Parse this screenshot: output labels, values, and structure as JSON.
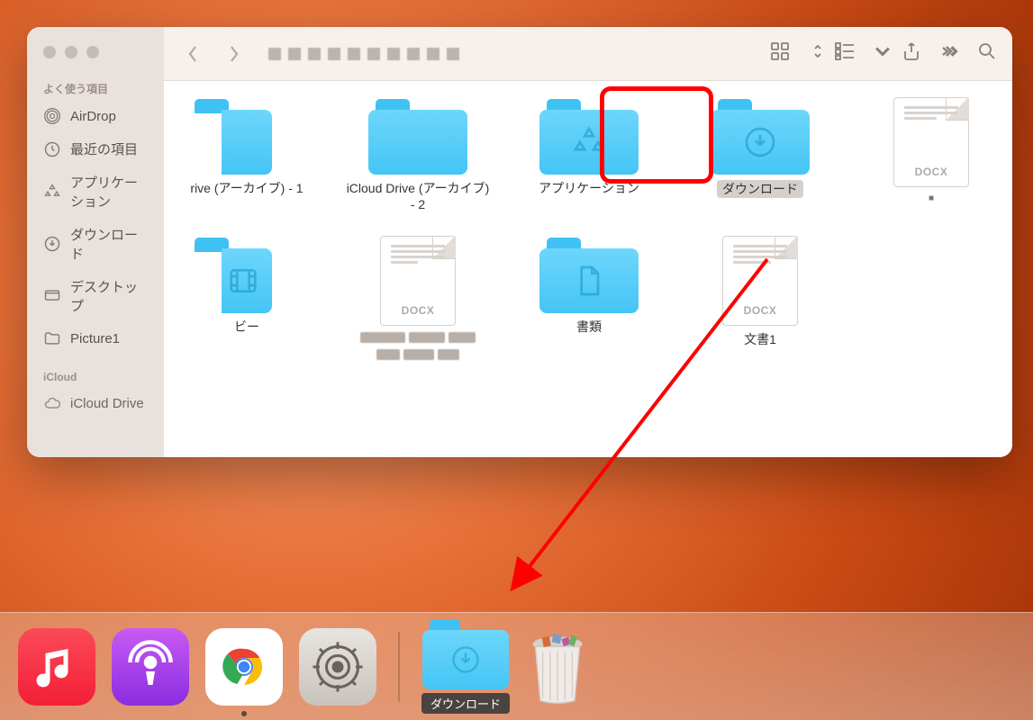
{
  "sidebar": {
    "favorites_header": "よく使う項目",
    "icloud_header": "iCloud",
    "items": [
      {
        "icon": "airdrop",
        "label": "AirDrop"
      },
      {
        "icon": "recent",
        "label": "最近の項目"
      },
      {
        "icon": "apps",
        "label": "アプリケーション"
      },
      {
        "icon": "download",
        "label": "ダウンロード"
      },
      {
        "icon": "desktop",
        "label": "デスクトップ"
      },
      {
        "icon": "folder",
        "label": "Picture1"
      }
    ],
    "icloud_items": [
      {
        "icon": "cloud",
        "label": "iCloud Drive"
      }
    ]
  },
  "content_items_row1": [
    {
      "type": "folder-cut",
      "label": "rive (アーカイブ) - 1"
    },
    {
      "type": "folder",
      "label": "iCloud Drive (アーカイブ) - 2"
    },
    {
      "type": "folder-app",
      "label": "アプリケーション"
    },
    {
      "type": "folder-dl",
      "label": "ダウンロード",
      "selected": true
    },
    {
      "type": "docx",
      "label": "■",
      "blur_small": true
    }
  ],
  "content_items_row2": [
    {
      "type": "folder-cut-movie",
      "label": "ビー"
    },
    {
      "type": "docx",
      "label_blurred": true
    },
    {
      "type": "folder-doc",
      "label": "書類"
    },
    {
      "type": "docx",
      "label": "文書1"
    }
  ],
  "docx_ext": "DOCX",
  "dock": {
    "downloads_label": "ダウンロード"
  }
}
